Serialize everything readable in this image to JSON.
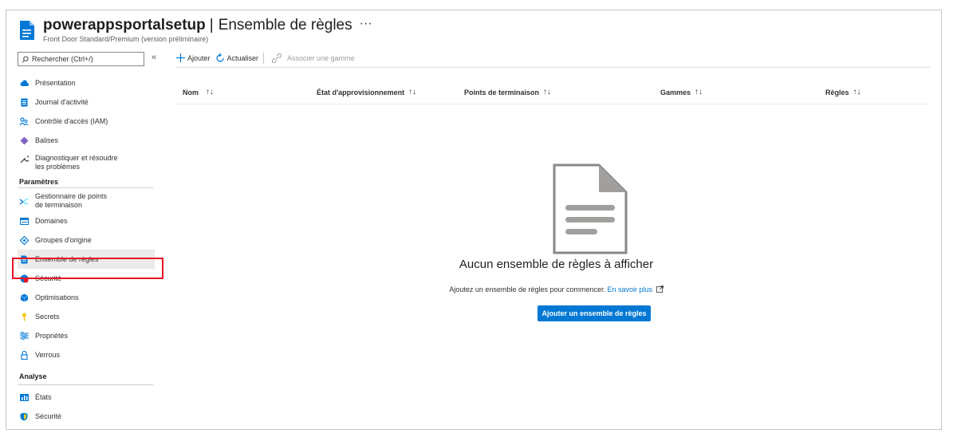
{
  "header": {
    "title": "powerappsportalsetup",
    "separator": "|",
    "page": "Ensemble de règles",
    "more": "···",
    "subtitle": "Front Door Standard/Premium (version préliminaire)"
  },
  "sidebar": {
    "search_placeholder": "Rechercher (Ctrl+/)",
    "collapse": "«",
    "items": [
      {
        "label": "Présentation",
        "icon": "cloud-icon"
      },
      {
        "label": "Journal d'activité",
        "icon": "log-icon"
      },
      {
        "label": "Contrôle d'accès (IAM)",
        "icon": "people-icon"
      },
      {
        "label": "Balises",
        "icon": "tag-icon"
      },
      {
        "label": "Diagnostiquer et résoudre les problèmes",
        "line1": "Diagnostiquer et résoudre",
        "line2": "les problèmes",
        "icon": "wrench-icon"
      }
    ],
    "section_parametres": "Paramètres",
    "parametres_items": [
      {
        "line1": "Gestionnaire de points",
        "line2": "de terminaison",
        "icon": "endpoint-icon"
      },
      {
        "label": "Domaines",
        "icon": "domains-icon"
      },
      {
        "label": "Groupes d'origine",
        "icon": "origin-groups-icon"
      },
      {
        "label": "Ensemble de règles",
        "icon": "ruleset-icon",
        "selected": true
      },
      {
        "label": "Sécurité",
        "icon": "security-icon"
      },
      {
        "label": "Optimisations",
        "icon": "cube-icon"
      },
      {
        "label": "Secrets",
        "icon": "key-icon"
      },
      {
        "label": "Propriétés",
        "icon": "properties-icon"
      },
      {
        "label": "Verrous",
        "icon": "lock-icon"
      }
    ],
    "section_analyse": "Analyse",
    "analyse_items": [
      {
        "label": "États",
        "icon": "reports-icon"
      },
      {
        "label": "Sécurité",
        "icon": "shield-icon"
      }
    ]
  },
  "toolbar": {
    "add": "Ajouter",
    "refresh": "Actualiser",
    "associate": "Associer une gamme"
  },
  "table": {
    "columns": [
      "Nom",
      "État d'approvisionnement",
      "Points de terminaison",
      "Gammes",
      "Règles"
    ],
    "sort_glyph": "↑↓"
  },
  "empty": {
    "title": "Aucun ensemble de règles à afficher",
    "desc": "Ajoutez un ensemble de règles pour commencer.",
    "link": "En savoir plus",
    "button": "Ajouter un ensemble de règles"
  },
  "colors": {
    "accent": "#0078d4",
    "highlight": "#e81123"
  }
}
